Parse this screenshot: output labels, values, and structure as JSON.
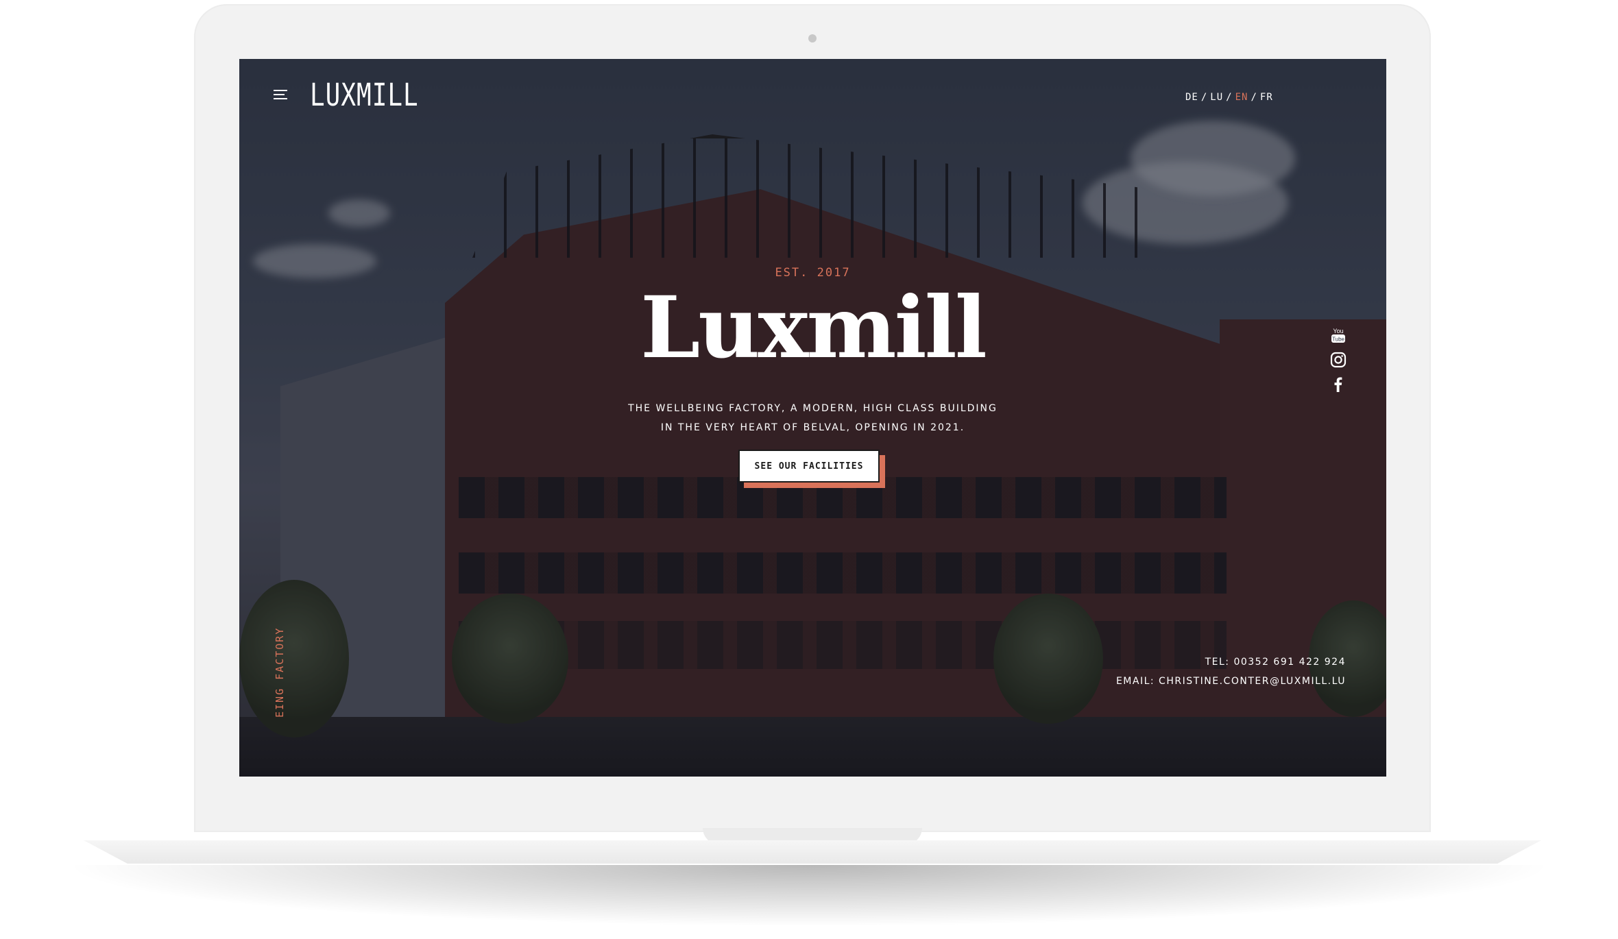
{
  "site": {
    "logo": "LUXMILL",
    "languages": [
      {
        "code": "DE",
        "active": false
      },
      {
        "code": "LU",
        "active": false
      },
      {
        "code": "EN",
        "active": true
      },
      {
        "code": "FR",
        "active": false
      }
    ],
    "lang_separator": "/"
  },
  "hero": {
    "established": "EST. 2017",
    "title": "Luxmill",
    "tagline_line1": "THE WELLBEING FACTORY, A MODERN, HIGH CLASS BUILDING",
    "tagline_line2": "IN THE VERY HEART OF BELVAL, OPENING IN 2021.",
    "cta_label": "SEE OUR FACILITIES"
  },
  "social": [
    {
      "name": "youtube-icon",
      "label": "You Tube"
    },
    {
      "name": "instagram-icon"
    },
    {
      "name": "facebook-icon"
    }
  ],
  "contact": {
    "phone": "TEL: 00352 691 422 924",
    "email": "EMAIL: CHRISTINE.CONTER@LUXMILL.LU"
  },
  "side_label": "EING FACTORY",
  "colors": {
    "accent": "#d9735a",
    "text": "#ffffff",
    "button_bg": "#ffffff",
    "button_border": "#1a1a1a"
  }
}
